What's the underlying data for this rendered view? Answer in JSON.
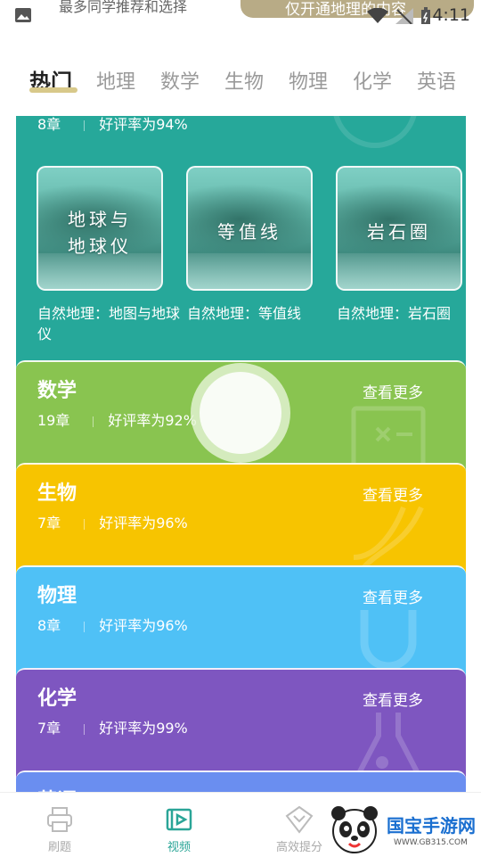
{
  "status_bar": {
    "ticker_text": "最多同学推荐和选择",
    "pill_text": "仅开通地理的内容",
    "time": "4:11",
    "icons": [
      "image-icon",
      "wifi-icon",
      "signal-off-icon",
      "battery-icon"
    ]
  },
  "tabs": [
    {
      "label": "热门",
      "active": true
    },
    {
      "label": "地理",
      "active": false
    },
    {
      "label": "数学",
      "active": false
    },
    {
      "label": "生物",
      "active": false
    },
    {
      "label": "物理",
      "active": false
    },
    {
      "label": "化学",
      "active": false
    },
    {
      "label": "英语",
      "active": false
    }
  ],
  "geography": {
    "chapters": "8章",
    "rating": "好评率为94%",
    "lessons": [
      {
        "thumb_lines": [
          "地球与",
          "地球仪"
        ],
        "caption": "自然地理：地图与地球仪"
      },
      {
        "thumb_lines": [
          "等值线"
        ],
        "caption": "自然地理：等值线"
      },
      {
        "thumb_lines": [
          "岩石圈"
        ],
        "caption": "自然地理：岩石圈"
      }
    ]
  },
  "subjects": [
    {
      "key": "math",
      "title": "数学",
      "chapters": "19章",
      "rating": "好评率为92%",
      "more": "查看更多",
      "color": "#89c450",
      "deco_icon": "blackboard-icon"
    },
    {
      "key": "bio",
      "title": "生物",
      "chapters": "7章",
      "rating": "好评率为96%",
      "more": "查看更多",
      "color": "#f7c400",
      "deco_icon": "dna-icon"
    },
    {
      "key": "phys",
      "title": "物理",
      "chapters": "8章",
      "rating": "好评率为96%",
      "more": "查看更多",
      "color": "#4fc1f6",
      "deco_icon": "magnet-icon"
    },
    {
      "key": "chem",
      "title": "化学",
      "chapters": "7章",
      "rating": "好评率为99%",
      "more": "查看更多",
      "color": "#7e56c0",
      "deco_icon": "flask-icon"
    },
    {
      "key": "eng",
      "title": "英语",
      "color": "#6a8ef0"
    }
  ],
  "bottom_nav": [
    {
      "label": "刷题",
      "icon": "printer-icon",
      "active": false
    },
    {
      "label": "视频",
      "icon": "video-icon",
      "active": true
    },
    {
      "label": "高效提分",
      "icon": "chevron-badge-icon",
      "active": false
    }
  ],
  "watermark": {
    "title": "国宝手游网",
    "url": "WWW.GB315.COM"
  },
  "colors": {
    "accent": "#2aa597",
    "geography": "#26a89a",
    "tab_underline": "#d8c98a"
  }
}
